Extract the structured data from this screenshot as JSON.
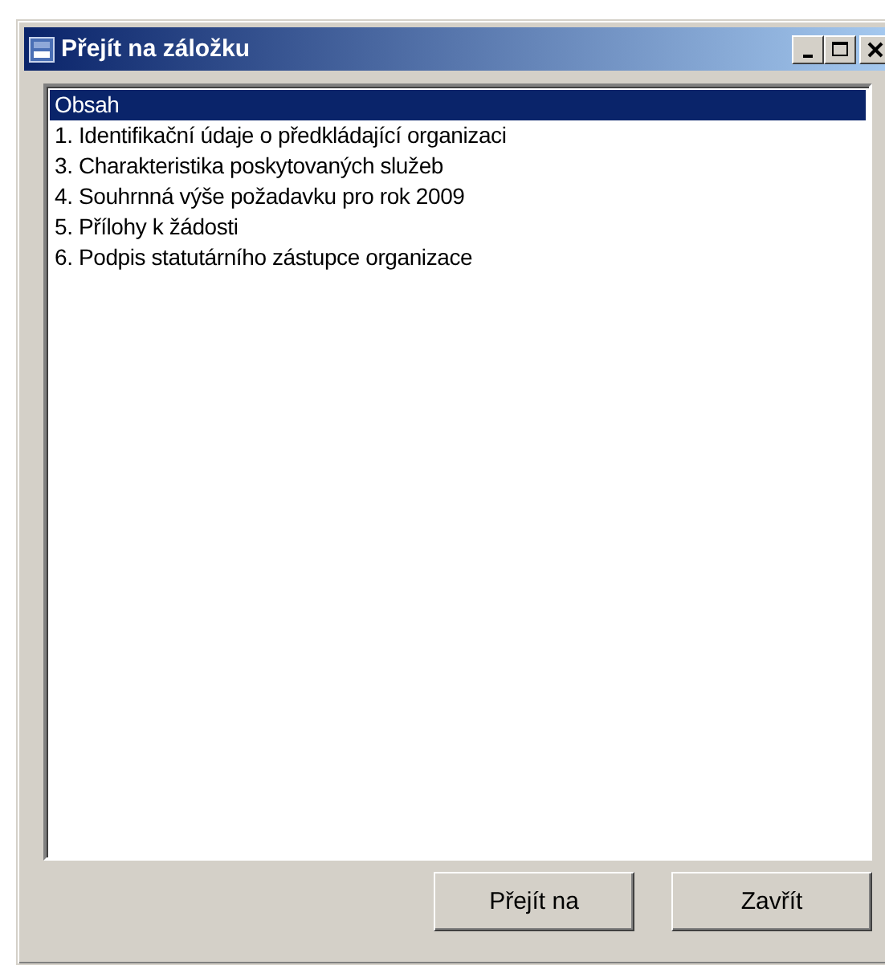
{
  "window": {
    "title": "Přejít na záložku"
  },
  "list": {
    "items": [
      {
        "label": "Obsah",
        "selected": true
      },
      {
        "label": "1. Identifikační údaje o předkládající organizaci",
        "selected": false
      },
      {
        "label": "3. Charakteristika poskytovaných služeb",
        "selected": false
      },
      {
        "label": "4. Souhrnná výše požadavku pro rok 2009",
        "selected": false
      },
      {
        "label": "5. Přílohy k žádosti",
        "selected": false
      },
      {
        "label": "6. Podpis statutárního zástupce organizace",
        "selected": false
      }
    ]
  },
  "buttons": [
    "Přejít na",
    "Zavřít"
  ]
}
